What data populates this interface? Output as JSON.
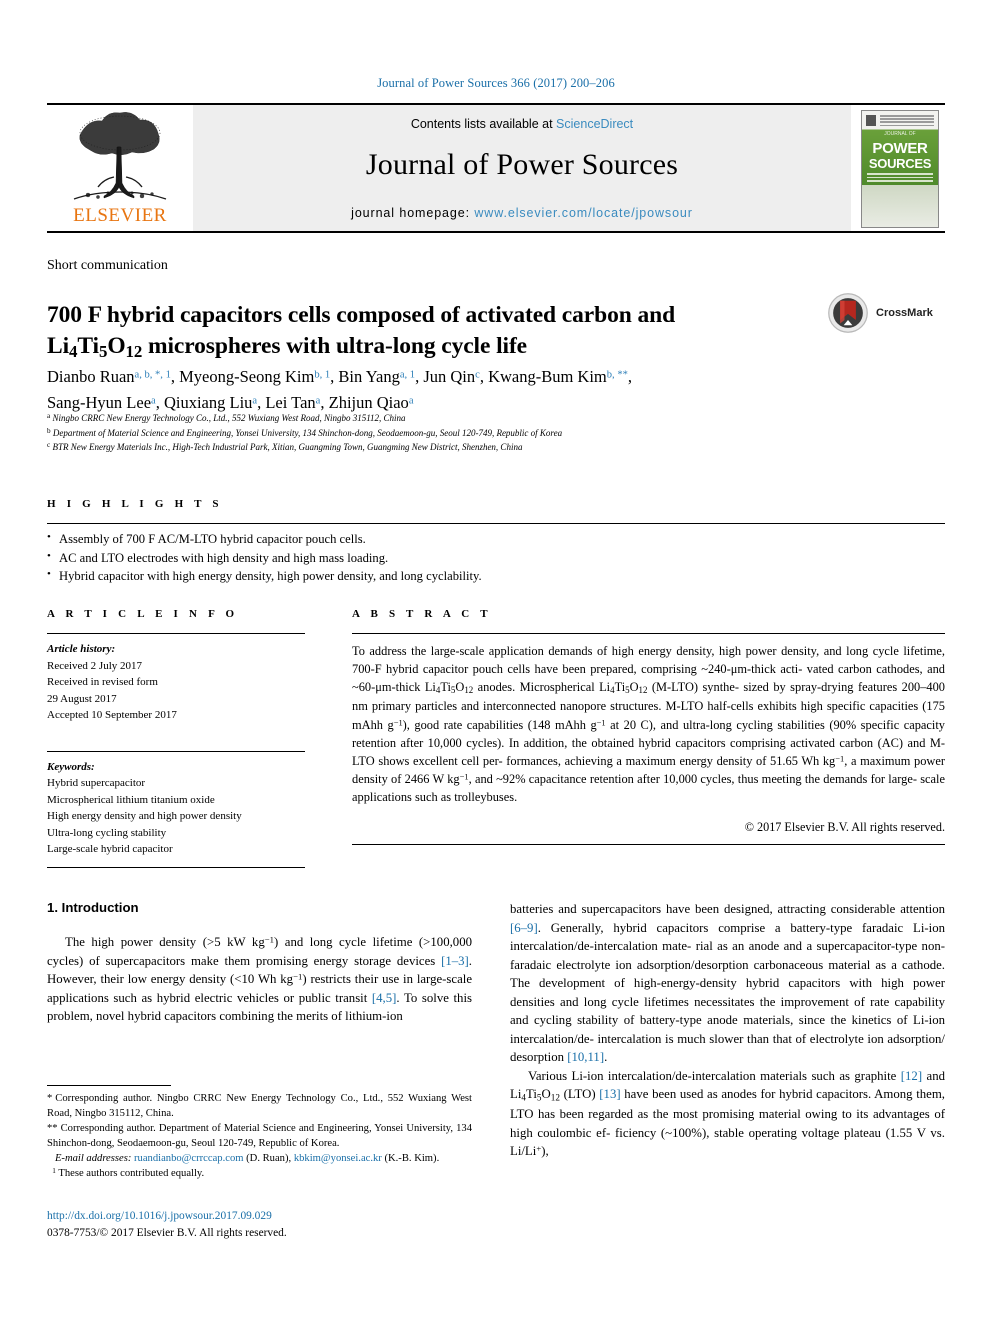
{
  "running_head": "Journal of Power Sources 366 (2017) 200–206",
  "masthead": {
    "contents_prefix": "Contents lists available at",
    "sciencedirect": "ScienceDirect",
    "journal_title": "Journal of Power Sources",
    "homepage_label": "journal homepage:",
    "homepage_url": "www.elsevier.com/locate/jpowsour",
    "publisher": "ELSEVIER",
    "cover": {
      "word1": "POWER",
      "word2": "SOURCES",
      "top_label": "JOURNAL OF"
    }
  },
  "article": {
    "type": "Short communication",
    "title_line1_a": "700 F hybrid capacitors cells composed of activated carbon and",
    "title_line2_a": "Li",
    "title_line2_sub1": "4",
    "title_line2_b": "Ti",
    "title_line2_sub2": "5",
    "title_line2_c": "O",
    "title_line2_sub3": "12",
    "title_line2_d": " microspheres with ultra-long cycle life",
    "crossmark_label": "CrossMark"
  },
  "authors": {
    "line1": [
      {
        "name": "Dianbo Ruan",
        "sup": "a, b, *, 1"
      },
      {
        "name": "Myeong-Seong Kim",
        "sup": "b, 1"
      },
      {
        "name": "Bin Yang",
        "sup": "a, 1"
      },
      {
        "name": "Jun Qin",
        "sup": "c"
      },
      {
        "name": "Kwang-Bum Kim",
        "sup": "b, **"
      }
    ],
    "line2": [
      {
        "name": "Sang-Hyun Lee",
        "sup": "a"
      },
      {
        "name": "Qiuxiang Liu",
        "sup": "a"
      },
      {
        "name": "Lei Tan",
        "sup": "a"
      },
      {
        "name": "Zhijun Qiao",
        "sup": "a"
      }
    ]
  },
  "affiliations": [
    {
      "mark": "a",
      "text": "Ningbo CRRC New Energy Technology Co., Ltd., 552 Wuxiang West Road, Ningbo 315112, China"
    },
    {
      "mark": "b",
      "text": "Department of Material Science and Engineering, Yonsei University, 134 Shinchon-dong, Seodaemoon-gu, Seoul 120-749, Republic of Korea"
    },
    {
      "mark": "c",
      "text": "BTR New Energy Materials Inc., High-Tech Industrial Park, Xitian, Guangming Town, Guangming New District, Shenzhen, China"
    }
  ],
  "highlights": {
    "label": "H I G H L I G H T S",
    "items": [
      "Assembly of 700 F AC/M-LTO hybrid capacitor pouch cells.",
      "AC and LTO electrodes with high density and high mass loading.",
      "Hybrid capacitor with high energy density, high power density, and long cyclability."
    ]
  },
  "article_info": {
    "label": "A R T I C L E   I N F O",
    "history_heading": "Article history:",
    "history": [
      "Received 2 July 2017",
      "Received in revised form",
      "29 August 2017",
      "Accepted 10 September 2017"
    ],
    "keywords_heading": "Keywords:",
    "keywords": [
      "Hybrid supercapacitor",
      "Microspherical lithium titanium oxide",
      "High energy density and high power density",
      "Ultra-long cycling stability",
      "Large-scale hybrid capacitor"
    ]
  },
  "abstract": {
    "label": "A B S T R A C T",
    "text": "To address the large-scale application demands of high energy density, high power density, and long cycle lifetime, 700-F hybrid capacitor pouch cells have been prepared, comprising ~240-μm-thick activated carbon cathodes, and ~60-μm-thick Li4Ti5O12 anodes. Microspherical Li4Ti5O12 (M-LTO) synthesized by spray-drying features 200–400 nm primary particles and interconnected nanopore structures. M-LTO half-cells exhibits high specific capacities (175 mAhh g−1), good rate capabilities (148 mAhh g−1 at 20 C), and ultra-long cycling stabilities (90% specific capacity retention after 10,000 cycles). In addition, the obtained hybrid capacitors comprising activated carbon (AC) and M-LTO shows excellent cell performances, achieving a maximum energy density of 51.65 Wh kg−1, a maximum power density of 2466 W kg−1, and ~92% capacitance retention after 10,000 cycles, thus meeting the demands for large-scale applications such as trolleybuses.",
    "copyright": "© 2017 Elsevier B.V. All rights reserved."
  },
  "introduction": {
    "heading": "1. Introduction",
    "left_p1": "The high power density (>5 kW kg−1) and long cycle lifetime (>100,000 cycles) of supercapacitors make them promising energy storage devices [1–3]. However, their low energy density (<10 Wh kg−1) restricts their use in large-scale applications such as hybrid electric vehicles or public transit [4,5]. To solve this problem, novel hybrid capacitors combining the merits of lithium-ion",
    "right_p1": "batteries and supercapacitors have been designed, attracting considerable attention [6–9]. Generally, hybrid capacitors comprise a battery-type faradaic Li-ion intercalation/de-intercalation material as an anode and a supercapacitor-type non-faradaic electrolyte ion adsorption/desorption carbonaceous material as a cathode. The development of high-energy-density hybrid capacitors with high power densities and long cycle lifetimes necessitates the improvement of rate capability and cycling stability of battery-type anode materials, since the kinetics of Li-ion intercalation/de-intercalation is much slower than that of electrolyte ion adsorption/desorption [10,11].",
    "right_p2": "Various Li-ion intercalation/de-intercalation materials such as graphite [12] and Li4Ti5O12 (LTO) [13] have been used as anodes for hybrid capacitors. Among them, LTO has been regarded as the most promising material owing to its advantages of high coulombic efficiency (~100%), stable operating voltage plateau (1.55 V vs. Li/Li+),"
  },
  "footnotes": {
    "corr1_mark": "*",
    "corr1": "Corresponding author. Ningbo CRRC New Energy Technology Co., Ltd., 552 Wuxiang West Road, Ningbo 315112, China.",
    "corr2_mark": "**",
    "corr2": "Corresponding author. Department of Material Science and Engineering, Yonsei University, 134 Shinchon-dong, Seodaemoon-gu, Seoul 120-749, Republic of Korea.",
    "email_label": "E-mail addresses:",
    "email1": "ruandianbo@crrccap.com",
    "email1_person": "(D. Ruan),",
    "email2": "kbkim@yonsei.ac.kr",
    "email2_person": "(K.-B. Kim).",
    "note1_mark": "1",
    "note1": "These authors contributed equally."
  },
  "footer": {
    "doi": "http://dx.doi.org/10.1016/j.jpowsour.2017.09.029",
    "issn_line": "0378-7753/© 2017 Elsevier B.V. All rights reserved."
  },
  "colors": {
    "link": "#1a6fa8",
    "sciencedirect": "#3a8bbf",
    "elsevier_orange": "#e87511",
    "superscript": "#2e7fb8"
  }
}
